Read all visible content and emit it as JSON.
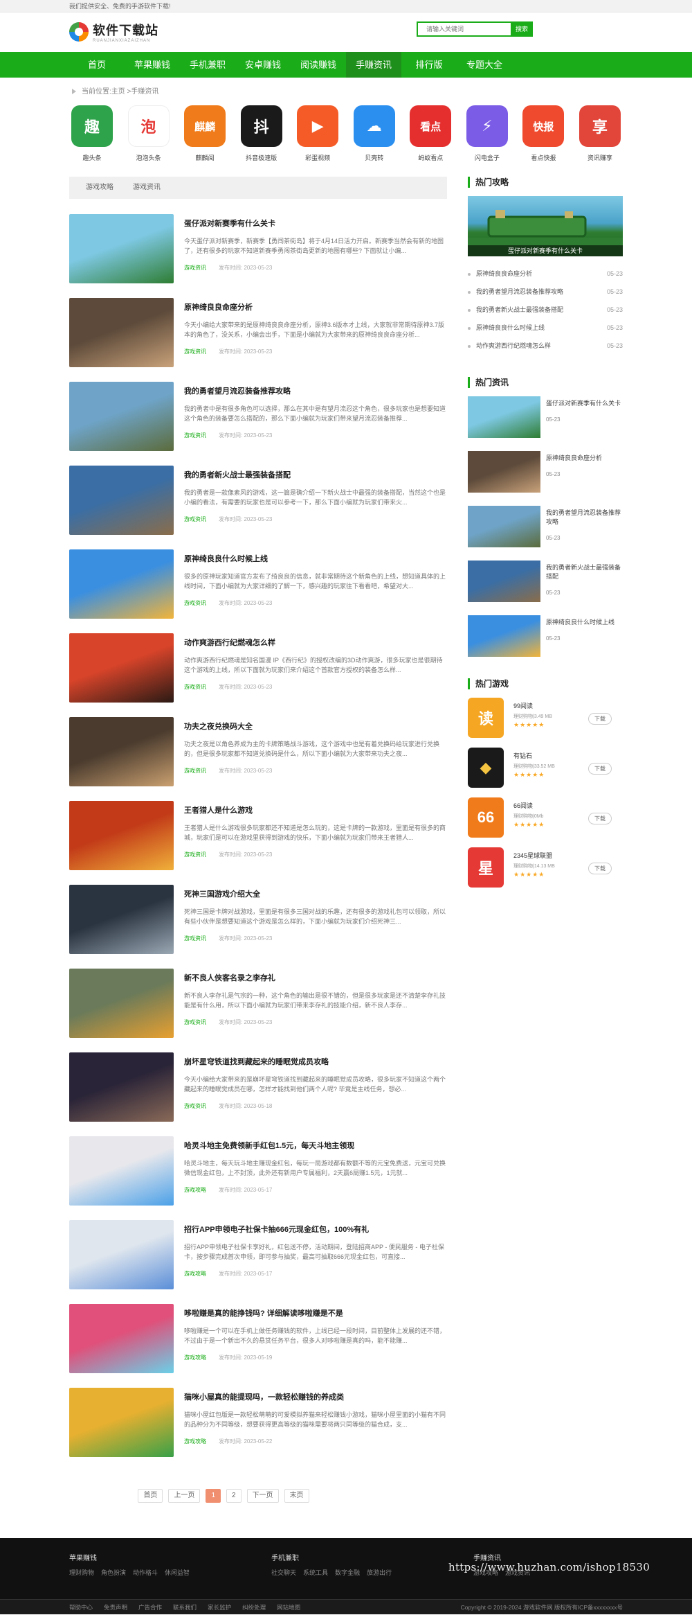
{
  "topbar": {
    "notice": "我们提供安全、免费的手游软件下载!"
  },
  "header": {
    "logo_text": "软件下载站",
    "logo_sub": "RUANJIANXIAZAIZHAN",
    "search_placeholder": "请输入关键词",
    "search_button": "搜索"
  },
  "nav": [
    "首页",
    "苹果赚钱",
    "手机兼职",
    "安卓赚钱",
    "阅读赚钱",
    "手赚资讯",
    "排行版",
    "专题大全"
  ],
  "nav_active": "手赚资讯",
  "breadcrumb": {
    "prefix": "当前位置:",
    "home": "主页",
    "sep": " >",
    "current": "手赚资讯"
  },
  "apps": [
    {
      "name": "趣头条",
      "glyph": "趣",
      "color": "#2fa34b"
    },
    {
      "name": "泡泡头条",
      "glyph": "泡",
      "color": "#ffffff"
    },
    {
      "name": "麒麟阅",
      "glyph": "麒麟",
      "color": "#f07b1a"
    },
    {
      "name": "抖音极速版",
      "glyph": "抖",
      "color": "#1a1a1a"
    },
    {
      "name": "彩蛋视频",
      "glyph": "▶",
      "color": "#f45b26"
    },
    {
      "name": "贝壳转",
      "glyph": "☁",
      "color": "#2b8ff0"
    },
    {
      "name": "蚂蚁看点",
      "glyph": "看点",
      "color": "#e52f2f"
    },
    {
      "name": "闪电盒子",
      "glyph": "⚡",
      "color": "#7b5ce6"
    },
    {
      "name": "看点快报",
      "glyph": "快报",
      "color": "#ef4a2e"
    },
    {
      "name": "资讯赚享",
      "glyph": "享",
      "color": "#e2463a"
    }
  ],
  "tabs": [
    "游戏攻略",
    "游戏资讯"
  ],
  "articles": [
    {
      "title": "蛋仔派对新赛季有什么关卡",
      "summary": "今天蛋仔派对新赛季，新赛季【勇闯茶街岛】将于4月14日活力开启。新赛季当然会有新的地图了，还有很多的玩家不知道新赛季勇闯茶街岛更新的地图有哪些? 下面就让小编...",
      "cat": "游戏资讯",
      "date_label": "发布时间:",
      "date": "2023-05-23"
    },
    {
      "title": "原神绮良良命座分析",
      "summary": "今天小编给大家带来的是原神绮良良命座分析，原神3.6版本才上线，大家就非常期待原神3.7版本的角色了，没关系，小编会出手，下面是小编就为大家带来的原神绮良良命座分析...",
      "cat": "游戏资讯",
      "date_label": "发布时间:",
      "date": "2023-05-23"
    },
    {
      "title": "我的勇者望月流忍装备推荐攻略",
      "summary": "我的勇者中是有很多角色可以选择，那么在其中是有望月流忍这个角色，很多玩家也是想要知道这个角色的装备要怎么搭配的，那么下面小编就为玩家们带来望月流忍装备推荐...",
      "cat": "游戏资讯",
      "date_label": "发布时间:",
      "date": "2023-05-23"
    },
    {
      "title": "我的勇者新火战士最强装备搭配",
      "summary": "我的勇者是一款像素风的游戏，这一篇是确介绍一下新火战士中最强的装备搭配，当然这个也是小编的看法，有需要的玩家也是可以参考一下，那么下面小编就为玩家们带来火...",
      "cat": "游戏资讯",
      "date_label": "发布时间:",
      "date": "2023-05-23"
    },
    {
      "title": "原神绮良良什么时候上线",
      "summary": "很多的原神玩家知道官方发布了绮良良的信息，就非常期待这个新角色的上线，想知道具体的上线时间，下面小编就为大家详细的了解一下，感兴趣的玩家往下看看吧，希望对大...",
      "cat": "游戏资讯",
      "date_label": "发布时间:",
      "date": "2023-05-23"
    },
    {
      "title": "动作爽游西行纪燃魂怎么样",
      "summary": "动作爽游西行纪燃魂是知名国漫 IP《西行纪》的授权改编的3D动作爽游，很多玩家也是很期待这个游戏的上线，所以下面就为玩家们来介绍这个首款官方授权的装备怎么样...",
      "cat": "游戏资讯",
      "date_label": "发布时间:",
      "date": "2023-05-23"
    },
    {
      "title": "功夫之夜兑换码大全",
      "summary": "功夫之夜是以角色养成为主的卡牌策略战斗游戏，这个游戏中也是有着兑换码给玩家进行兑换的，但是很多玩家都不知道兑换码是什么，所以下面小编就为大家带来功夫之夜...",
      "cat": "游戏资讯",
      "date_label": "发布时间:",
      "date": "2023-05-23"
    },
    {
      "title": "王者猎人是什么游戏",
      "summary": "王者猎人是什么游戏很多玩家都还不知道是怎么玩的，这是卡牌的一款游戏，里面是有很多的商城，玩家们是可以在游戏里获得到游戏的快乐，下面小编就为玩家们带来王者猎人...",
      "cat": "游戏资讯",
      "date_label": "发布时间:",
      "date": "2023-05-23"
    },
    {
      "title": "死神三国游戏介绍大全",
      "summary": "死神三国是卡牌对战游戏，里面是有很多三国对战的乐趣，还有很多的游戏礼包可以领取，所以有些小伙伴是想要知道这个游戏是怎么样的，下面小编就为玩家们介绍死神三...",
      "cat": "游戏资讯",
      "date_label": "发布时间:",
      "date": "2023-05-23"
    },
    {
      "title": "新不良人侠客名录之李存礼",
      "summary": "新不良人李存礼是气宗的一种，这个角色的输出是很不错的，但是很多玩家是还不清楚李存礼技能是有什么用，所以下面小编就为玩家们带来李存礼的技能介绍，新不良人李存...",
      "cat": "游戏资讯",
      "date_label": "发布时间:",
      "date": "2023-05-23"
    },
    {
      "title": "崩坏星穹铁道找到藏起来的睡眠觉成员攻略",
      "summary": "今天小编给大家带来的是崩坏星穹铁道找到藏起来的睡眠觉成员攻略，很多玩家不知道这个两个藏起来的睡眠觉成员在哪，怎样才能找到他们两个人呢? 毕竟是主线任务，想必...",
      "cat": "游戏资讯",
      "date_label": "发布时间:",
      "date": "2023-05-18"
    },
    {
      "title": "哈灵斗地主免费领新手红包1.5元，每天斗地主领现",
      "summary": "哈灵斗地主，每天玩斗地主赚现金红包，每玩一局游戏都有数额不等的元宝免费送，元宝可兑换微信现金红包，上不封顶，此外还有新用户专属福利，2天赢6局赚1.5元，1元就...",
      "cat": "游戏攻略",
      "date_label": "发布时间:",
      "date": "2023-05-17"
    },
    {
      "title": "招行APP申领电子社保卡抽666元现金红包，100%有礼",
      "summary": "招行APP申领电子社保卡享好礼，红包送不停，活动期间，登陆招商APP - 便民服务 - 电子社保卡，按步骤完成首次申领，即可参与抽奖，最高可抽取666元现金红包，可直接...",
      "cat": "游戏攻略",
      "date_label": "发布时间:",
      "date": "2023-05-17"
    },
    {
      "title": "哆啦赚是真的能挣钱吗? 详细解读哆啦赚是不是",
      "summary": "哆啦赚是一个可以在手机上做任务赚钱的软件，上线已经一段时间，目前整体上发展的还不错，不过由于是一个新出不久的悬赏任务平台，很多人对哆啦赚是真的吗，能不能赚...",
      "cat": "游戏攻略",
      "date_label": "发布时间:",
      "date": "2023-05-19"
    },
    {
      "title": "猫咪小屋真的能提现吗，一款轻松赚钱的养成类",
      "summary": "猫咪小屋红包版是一款轻松萌萌的可爱模拟养猫来轻松赚钱小游戏，猫咪小屋里面的小猫有不同的品种分为不同等级，想要获得更高等级的猫咪需要将两只同等级的猫合成，支...",
      "cat": "游戏攻略",
      "date_label": "发布时间:",
      "date": "2023-05-22"
    }
  ],
  "pager": [
    "首页",
    "上一页",
    "1",
    "2",
    "下一页",
    "末页"
  ],
  "pager_active": "1",
  "sidebar": {
    "hot_guides_title": "热门攻略",
    "hot_pic_caption": "蛋仔派对新赛季有什么关卡",
    "hot_guides": [
      {
        "title": "原神绮良良命座分析",
        "date": "05-23"
      },
      {
        "title": "我的勇者望月流忍装备推荐攻略",
        "date": "05-23"
      },
      {
        "title": "我的勇者新火战士最强装备搭配",
        "date": "05-23"
      },
      {
        "title": "原神绮良良什么时候上线",
        "date": "05-23"
      },
      {
        "title": "动作爽游西行纪燃魂怎么样",
        "date": "05-23"
      }
    ],
    "hot_news_title": "热门资讯",
    "hot_news": [
      {
        "title": "蛋仔派对新赛季有什么关卡",
        "date": "05-23"
      },
      {
        "title": "原神绮良良命座分析",
        "date": "05-23"
      },
      {
        "title": "我的勇者望月流忍装备推荐攻略",
        "date": "05-23"
      },
      {
        "title": "我的勇者新火战士最强装备搭配",
        "date": "05-23"
      },
      {
        "title": "原神绮良良什么时候上线",
        "date": "05-23"
      }
    ],
    "hot_games_title": "热门游戏",
    "hot_games": [
      {
        "name": "99阅读",
        "spec": "理财购物|3.49 MB",
        "stars": "★★★★★",
        "btn": "下载",
        "glyph": "读",
        "color": "#f5a623"
      },
      {
        "name": "有钻石",
        "spec": "理财购物|33.52 MB",
        "stars": "★★★★★",
        "btn": "下载",
        "glyph": "◆",
        "color": "#1a1a1a"
      },
      {
        "name": "66阅读",
        "spec": "理财购物|0Mb",
        "stars": "★★★★★",
        "btn": "下载",
        "glyph": "66",
        "color": "#f07b1a"
      },
      {
        "name": "2345星球联盟",
        "spec": "理财购物|14.13 MB",
        "stars": "★★★★★",
        "btn": "下载",
        "glyph": "星",
        "color": "#e53935"
      }
    ]
  },
  "footer": {
    "cols": [
      {
        "title": "苹果赚钱",
        "links": [
          "理财购物",
          "角色扮演",
          "动作格斗",
          "休闲益智"
        ]
      },
      {
        "title": "手机兼职",
        "links": [
          "社交聊天",
          "系统工具",
          "数字金融",
          "旅游出行"
        ]
      },
      {
        "title": "手赚资讯",
        "links": [
          "游戏攻略",
          "游戏资讯"
        ]
      }
    ],
    "bottom_links": [
      "帮助中心",
      "免责声明",
      "广告合作",
      "联系我们",
      "家长监护",
      "纠纷处理",
      "网站地图"
    ],
    "copyright": "Copyright © 2019-2024 游戏软件网 版权所有ICP备xxxxxxxx号",
    "watermark": "https://www.huzhan.com/ishop18530"
  }
}
